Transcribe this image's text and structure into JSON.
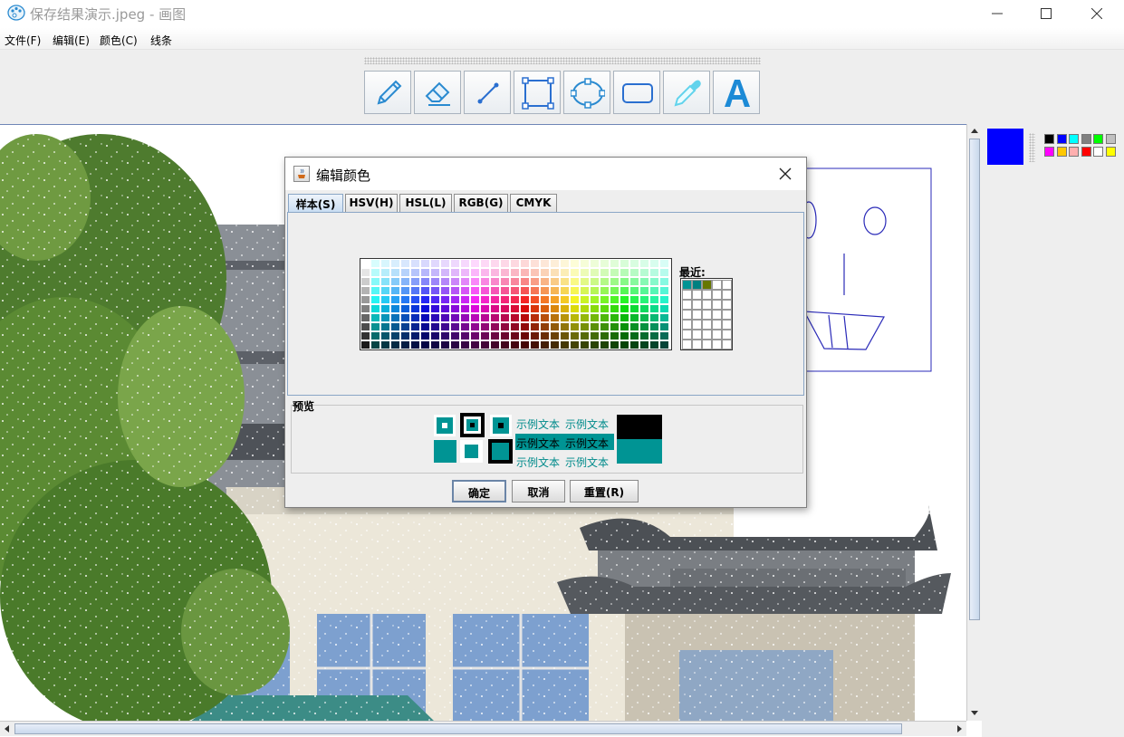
{
  "window": {
    "title": "保存结果演示.jpeg - 画图"
  },
  "menu": {
    "items": [
      "文件(F)",
      "编辑(E)",
      "颜色(C)",
      "线条"
    ]
  },
  "toolbar": {
    "tools": [
      "pencil-icon",
      "eraser-icon",
      "line-icon",
      "rectangle-select-icon",
      "ellipse-icon",
      "rounded-rectangle-icon",
      "eyedropper-icon",
      "text-icon"
    ]
  },
  "palette": {
    "current_color": "#0000ff",
    "swatches": [
      "#000000",
      "#0000ff",
      "#00ffff",
      "#808080",
      "#00ff00",
      "#c0c0c0",
      "#ff00ff",
      "#ffc800",
      "#ffafaf",
      "#ff0000",
      "#ffffff",
      "#ffff00"
    ]
  },
  "dialog": {
    "title": "编辑颜色",
    "tabs": [
      {
        "label": "样本(S)",
        "active": true
      },
      {
        "label": "HSV(H)",
        "active": false
      },
      {
        "label": "HSL(L)",
        "active": false
      },
      {
        "label": "RGB(G)",
        "active": false
      },
      {
        "label": "CMYK",
        "active": false
      }
    ],
    "recent_label": "最近:",
    "recent_colors": [
      "#009494",
      "#008080",
      "#667700"
    ],
    "preview_label": "预览",
    "sample_text": "示例文本",
    "preview_color": "#009494",
    "buttons": {
      "ok": "确定",
      "cancel": "取消",
      "reset": "重置(R)"
    }
  }
}
